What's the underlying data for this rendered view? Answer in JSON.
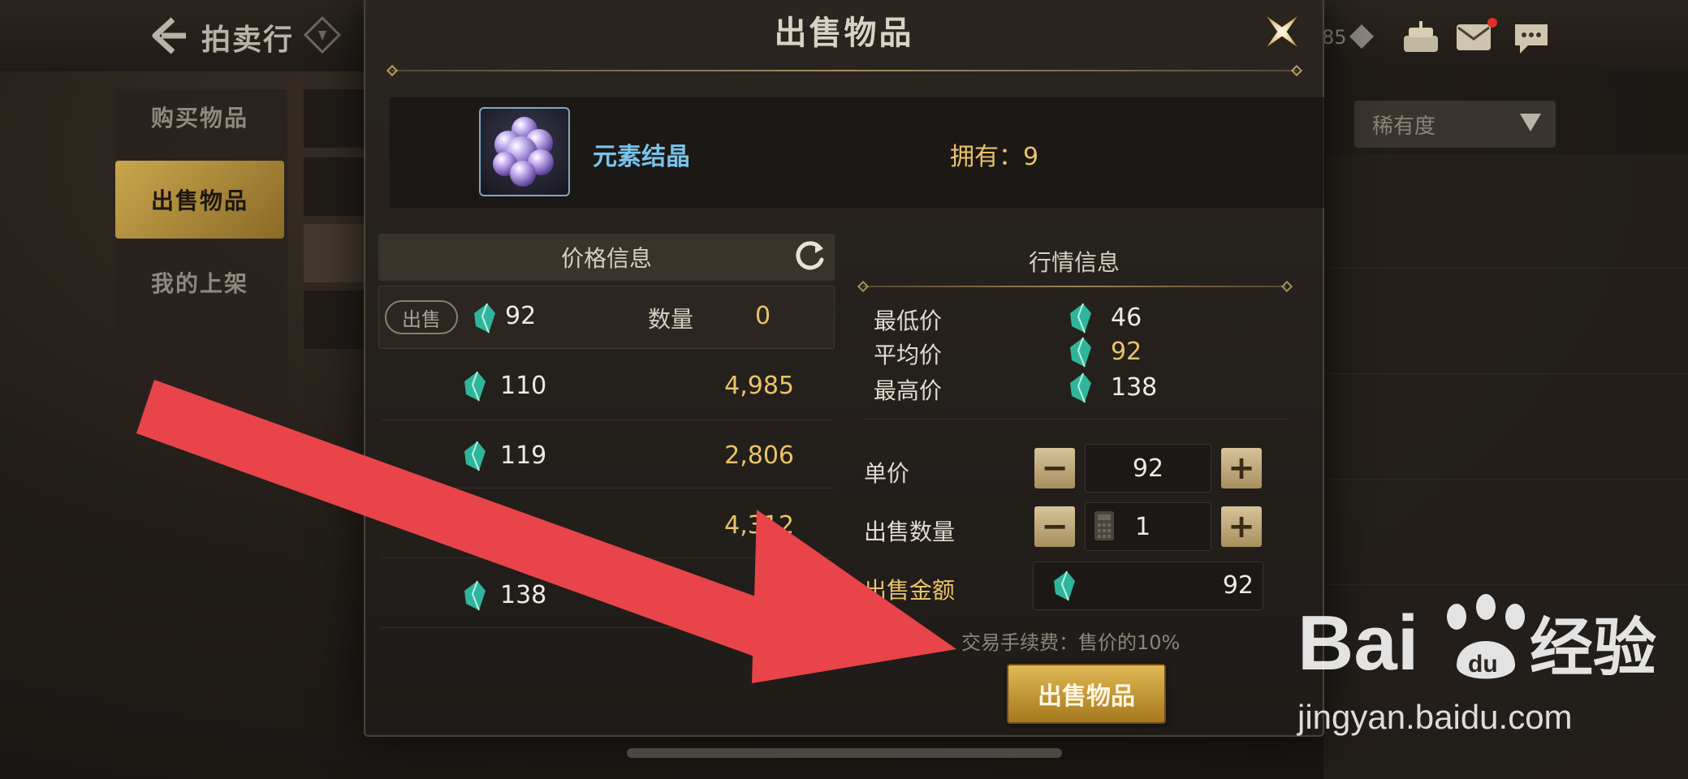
{
  "top_bar": {
    "page_title": "拍卖行",
    "currency_partial": "85"
  },
  "sidebar": {
    "items": [
      {
        "label": "购买物品",
        "active": false
      },
      {
        "label": "出售物品",
        "active": true
      },
      {
        "label": "我的上架",
        "active": false
      }
    ]
  },
  "background_filter": {
    "rarity_label": "稀有度"
  },
  "modal": {
    "title": "出售物品",
    "item": {
      "name": "元素结晶",
      "owned_text": "拥有：9",
      "icon": "purple-crystal-cluster"
    },
    "price_info": {
      "header": "价格信息",
      "my_listing": {
        "tag": "出售",
        "price": "92",
        "qty_label": "数量",
        "qty": "0"
      },
      "rows": [
        {
          "price": "110",
          "count": "4,985"
        },
        {
          "price": "119",
          "count": "2,806"
        },
        {
          "price": "",
          "count": "4,312"
        },
        {
          "price": "138",
          "count": ""
        }
      ]
    },
    "market_info": {
      "header": "行情信息",
      "rows": [
        {
          "label": "最低价",
          "value": "46",
          "highlight": false
        },
        {
          "label": "平均价",
          "value": "92",
          "highlight": true
        },
        {
          "label": "最高价",
          "value": "138",
          "highlight": false
        }
      ]
    },
    "form": {
      "unit_price_label": "单价",
      "unit_price": "92",
      "quantity_label": "出售数量",
      "quantity": "1",
      "total_label": "出售金额",
      "total": "92",
      "minus": "−",
      "plus": "+"
    },
    "fee_note": "交易手续费：售价的10%",
    "sell_button": "出售物品"
  },
  "watermark": {
    "logo_text": "Bai",
    "logo_text2": "经验",
    "url": "jingyan.baidu.com"
  },
  "colors": {
    "gold_text": "#e8c36a",
    "item_name": "#79c3ea",
    "arrow": "#e8444a",
    "button_gold": "#d1a53e"
  }
}
